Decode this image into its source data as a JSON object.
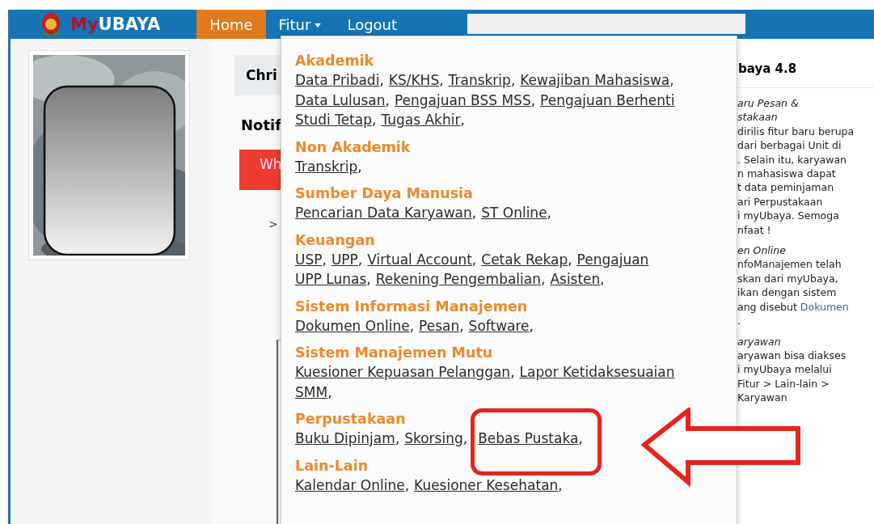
{
  "navbar": {
    "brand": {
      "part_1": "My",
      "part_2": "UBAYA"
    },
    "items": [
      {
        "label": "Home",
        "selected": true,
        "dropdown": false
      },
      {
        "label": "Fitur",
        "selected": false,
        "dropdown": true
      },
      {
        "label": "Logout",
        "selected": false,
        "dropdown": false
      }
    ]
  },
  "main": {
    "header": "Chri",
    "notification_title": "Notif",
    "alert_button": "Wh",
    "chevron": ">"
  },
  "dropdown_menu": {
    "sections": [
      {
        "title": "Akademik",
        "lines": [
          [
            {
              "label": "Data Pribadi",
              "sep": ","
            },
            {
              "label": "KS/KHS",
              "sep": ","
            },
            {
              "label": "Transkrip",
              "sep": ","
            },
            {
              "label": "Kewajiban Mahasiswa",
              "sep": ","
            }
          ],
          [
            {
              "label": "Data Lulusan",
              "sep": ","
            },
            {
              "label": "Pengajuan BSS MSS",
              "sep": ","
            },
            {
              "label": "Pengajuan Berhenti"
            }
          ],
          [
            {
              "label": "Studi Tetap",
              "sep": ","
            },
            {
              "label": "Tugas Akhir",
              "sep": ","
            }
          ]
        ]
      },
      {
        "title": "Non Akademik",
        "lines": [
          [
            {
              "label": "Transkrip",
              "sep": ","
            }
          ]
        ]
      },
      {
        "title": "Sumber Daya Manusia",
        "lines": [
          [
            {
              "label": "Pencarian Data Karyawan",
              "sep": ","
            },
            {
              "label": "ST Online",
              "sep": ","
            }
          ]
        ]
      },
      {
        "title": "Keuangan",
        "lines": [
          [
            {
              "label": "USP",
              "sep": ","
            },
            {
              "label": "UPP",
              "sep": ","
            },
            {
              "label": "Virtual Account",
              "sep": ","
            },
            {
              "label": "Cetak Rekap",
              "sep": ","
            },
            {
              "label": "Pengajuan"
            }
          ],
          [
            {
              "label": "UPP Lunas",
              "sep": ","
            },
            {
              "label": "Rekening Pengembalian",
              "sep": ","
            },
            {
              "label": "Asisten",
              "sep": ","
            }
          ]
        ]
      },
      {
        "title": "Sistem Informasi Manajemen",
        "lines": [
          [
            {
              "label": "Dokumen Online",
              "sep": ","
            },
            {
              "label": "Pesan",
              "sep": ","
            },
            {
              "label": "Software",
              "sep": ","
            }
          ]
        ]
      },
      {
        "title": "Sistem Manajemen Mutu",
        "lines": [
          [
            {
              "label": "Kuesioner Kepuasan Pelanggan",
              "sep": ","
            },
            {
              "label": "Lapor Ketidaksesuaian"
            }
          ],
          [
            {
              "label": "SMM",
              "sep": ","
            }
          ]
        ]
      },
      {
        "title": "Perpustakaan",
        "lines": [
          [
            {
              "label": "Buku Dipinjam",
              "sep": ","
            },
            {
              "label": "Skorsing",
              "sep": ","
            },
            {
              "label": "Bebas Pustaka",
              "sep": ",",
              "highlighted": true
            }
          ]
        ]
      },
      {
        "title": "Lain-Lain",
        "lines": [
          [
            {
              "label": "Kalendar Online",
              "sep": ","
            },
            {
              "label": "Kuesioner Kesehatan",
              "sep": ","
            }
          ]
        ]
      }
    ]
  },
  "news_panel": {
    "title": "baya 4.8",
    "paragraphs": [
      {
        "lines": [
          {
            "text": "aru Pesan &",
            "italic": true
          },
          {
            "text": "stakaan",
            "italic": true
          },
          {
            "text": "dirilis fitur baru berupa"
          },
          {
            "text": "dari berbagai Unit di"
          },
          {
            "text": ". Selain itu, karyawan"
          },
          {
            "text": "n mahasiswa dapat"
          },
          {
            "text": "t data peminjaman"
          },
          {
            "text": "ari Perpustakaan"
          },
          {
            "text": "i myUbaya. Semoga"
          },
          {
            "text": "nfaat !"
          }
        ]
      },
      {
        "lines": [
          {
            "text": "en Online",
            "italic": true
          },
          {
            "text": "nfoManajemen telah"
          },
          {
            "text": "skan dari myUbaya,"
          },
          {
            "text": "ikan dengan sistem"
          },
          {
            "text": "ang disebut",
            "link": "Dokumen"
          },
          {
            "text": "."
          }
        ]
      },
      {
        "lines": [
          {
            "text": "aryawan",
            "italic": true
          },
          {
            "text": "aryawan bisa diakses"
          },
          {
            "text": "i myUbaya melalui"
          },
          {
            "text": "Fitur > Lain-lain >"
          },
          {
            "text": "Karyawan"
          }
        ]
      }
    ]
  }
}
